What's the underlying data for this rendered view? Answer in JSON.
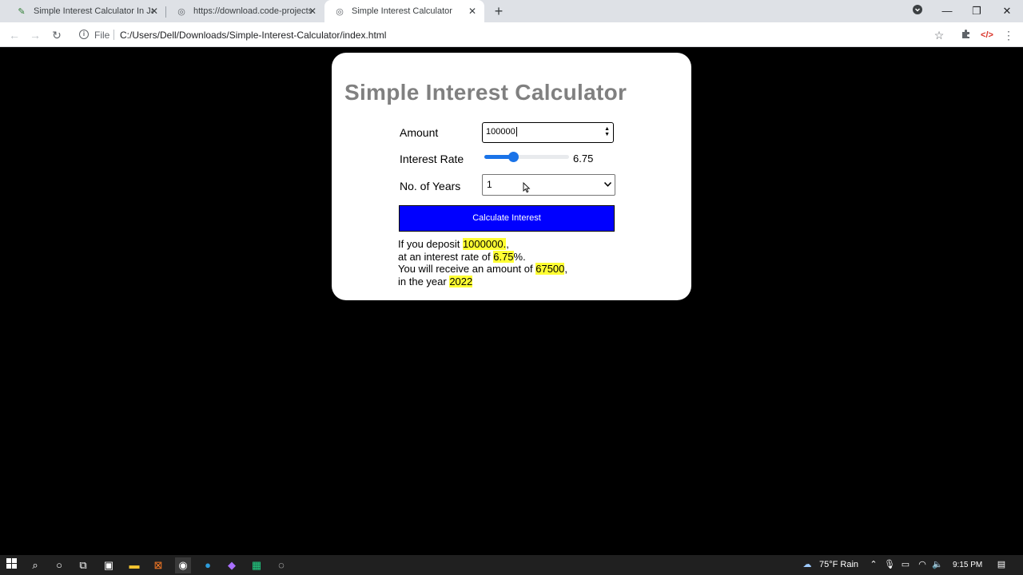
{
  "browser": {
    "tabs": [
      {
        "title": "Simple Interest Calculator In Java",
        "icon": "pen-icon"
      },
      {
        "title": "https://download.code-projects.o",
        "icon": "globe-icon"
      },
      {
        "title": "Simple Interest Calculator",
        "icon": "globe-icon"
      }
    ],
    "file_label": "File",
    "url": "C:/Users/Dell/Downloads/Simple-Interest-Calculator/index.html"
  },
  "page": {
    "title": "Simple Interest Calculator",
    "amount_label": "Amount",
    "amount_value": "100000",
    "rate_label": "Interest Rate",
    "rate_value": "6.75",
    "rate_fraction": 0.34,
    "years_label": "No. of Years",
    "years_value": "1",
    "button_label": "Calculate Interest",
    "result": {
      "line1_prefix": "If you deposit ",
      "deposit": "1000000.",
      "line1_suffix": ",",
      "line2_prefix": "at an interest rate of ",
      "rate": "6.75",
      "line2_suffix": "%.",
      "line3_prefix": "You will receive an amount of ",
      "amount": "67500",
      "line3_suffix": ",",
      "line4_prefix": "in the year ",
      "year": "2022"
    }
  },
  "taskbar": {
    "weather": "75°F  Rain",
    "time": "9:15 PM"
  },
  "colors": {
    "button": "#0000ff",
    "highlight": "#ffff33",
    "slider": "#1a73e8",
    "title": "#808080"
  }
}
